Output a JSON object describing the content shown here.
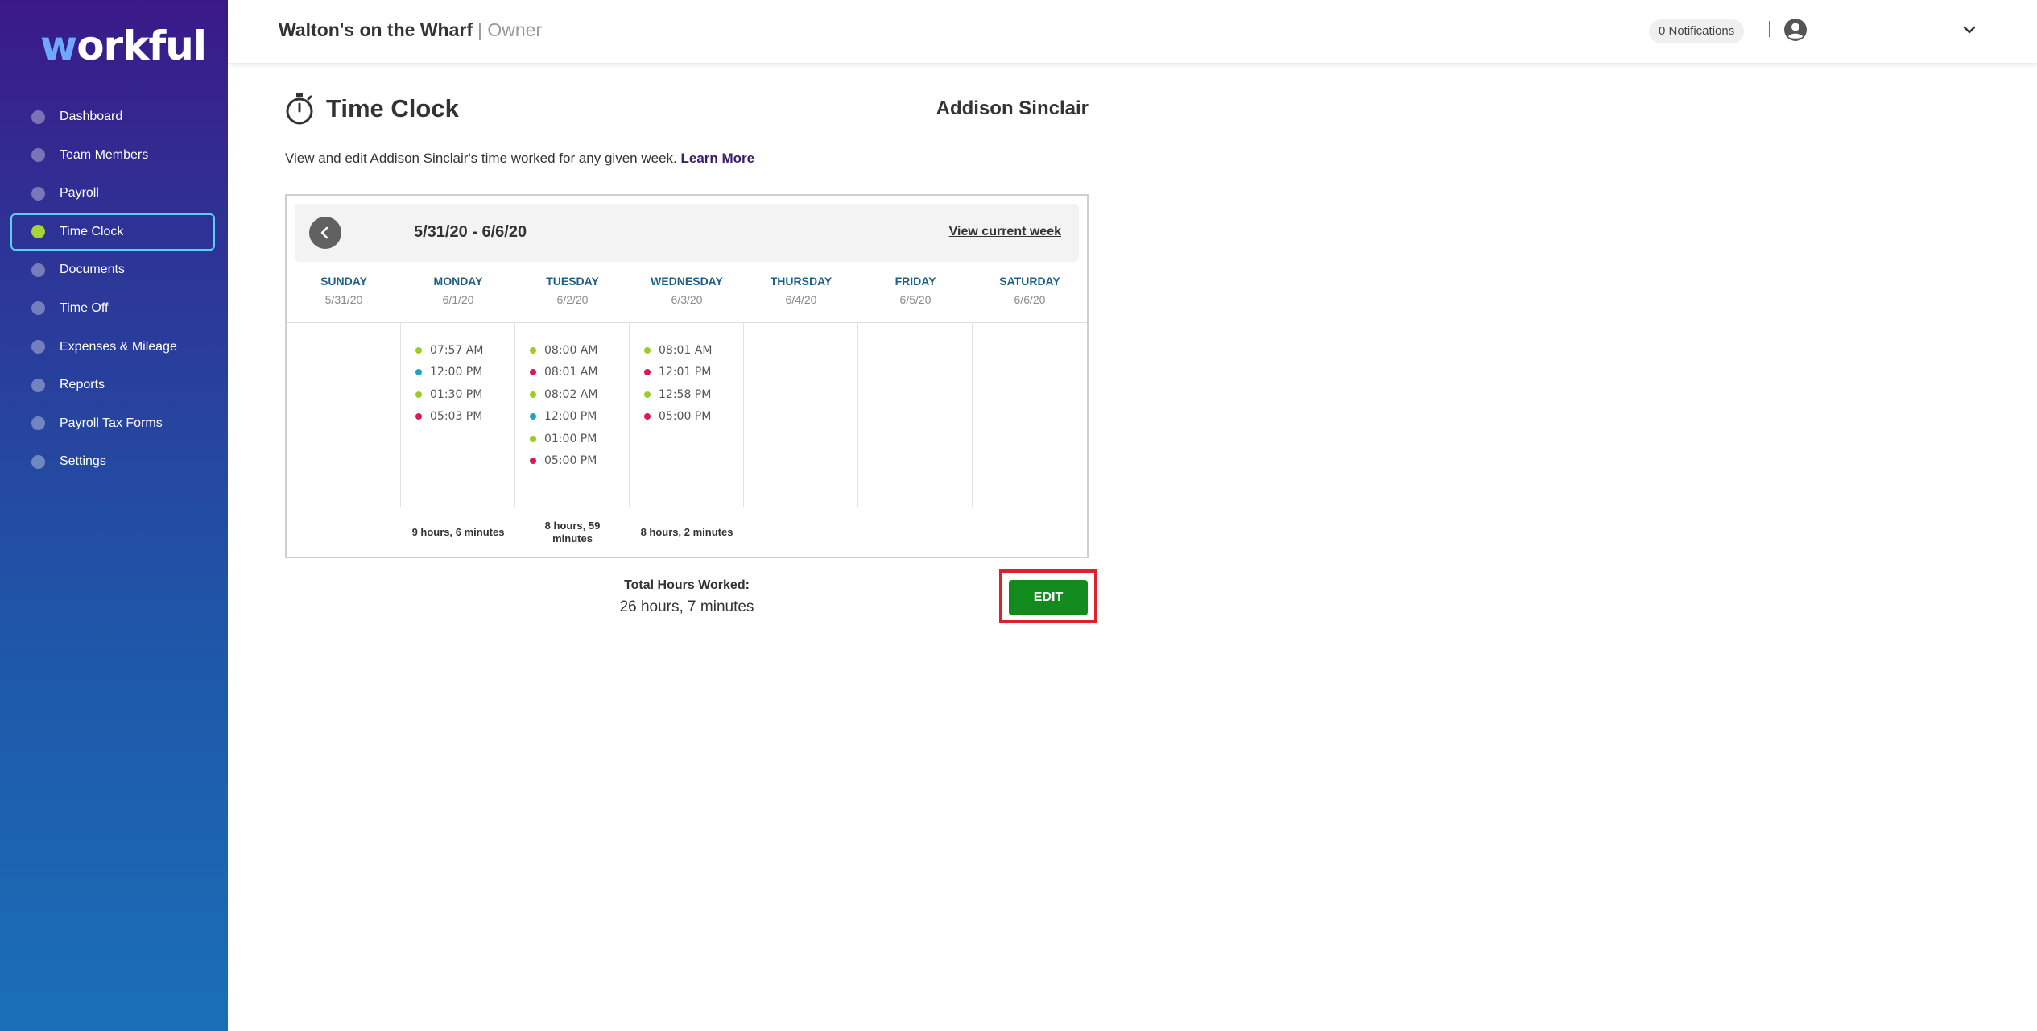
{
  "sidebar": {
    "logo": {
      "prefix": "w",
      "rest": "orkful"
    },
    "items": [
      {
        "label": "Dashboard",
        "active": false
      },
      {
        "label": "Team Members",
        "active": false
      },
      {
        "label": "Payroll",
        "active": false
      },
      {
        "label": "Time Clock",
        "active": true
      },
      {
        "label": "Documents",
        "active": false
      },
      {
        "label": "Time Off",
        "active": false
      },
      {
        "label": "Expenses & Mileage",
        "active": false
      },
      {
        "label": "Reports",
        "active": false
      },
      {
        "label": "Payroll Tax Forms",
        "active": false
      },
      {
        "label": "Settings",
        "active": false
      }
    ]
  },
  "header": {
    "company": "Walton's on the Wharf",
    "role": "| Owner",
    "notifications": "0 Notifications",
    "separator": "|",
    "icons": {
      "user": "user-circle-icon",
      "menu": "chevron-down-icon"
    }
  },
  "page": {
    "title": "Time Clock",
    "employee": "Addison Sinclair",
    "description": "View and edit Addison Sinclair's time worked for any given week.",
    "learn_more": "Learn More",
    "icon": "stopwatch-icon"
  },
  "week": {
    "range": "5/31/20 - 6/6/20",
    "view_current": "View current week",
    "prev_icon": "chevron-left-icon",
    "days": [
      {
        "name": "SUNDAY",
        "date": "5/31/20",
        "punches": [],
        "total": ""
      },
      {
        "name": "MONDAY",
        "date": "6/1/20",
        "punches": [
          {
            "time": "07:57 AM",
            "type": "in"
          },
          {
            "time": "12:00 PM",
            "type": "break"
          },
          {
            "time": "01:30 PM",
            "type": "in"
          },
          {
            "time": "05:03 PM",
            "type": "out"
          }
        ],
        "total": "9 hours, 6 minutes"
      },
      {
        "name": "TUESDAY",
        "date": "6/2/20",
        "punches": [
          {
            "time": "08:00 AM",
            "type": "in"
          },
          {
            "time": "08:01 AM",
            "type": "out"
          },
          {
            "time": "08:02 AM",
            "type": "in"
          },
          {
            "time": "12:00 PM",
            "type": "break"
          },
          {
            "time": "01:00 PM",
            "type": "in"
          },
          {
            "time": "05:00 PM",
            "type": "out"
          }
        ],
        "total": "8 hours, 59 minutes"
      },
      {
        "name": "WEDNESDAY",
        "date": "6/3/20",
        "punches": [
          {
            "time": "08:01 AM",
            "type": "in"
          },
          {
            "time": "12:01 PM",
            "type": "out"
          },
          {
            "time": "12:58 PM",
            "type": "in"
          },
          {
            "time": "05:00 PM",
            "type": "out"
          }
        ],
        "total": "8 hours, 2 minutes"
      },
      {
        "name": "THURSDAY",
        "date": "6/4/20",
        "punches": [],
        "total": ""
      },
      {
        "name": "FRIDAY",
        "date": "6/5/20",
        "punches": [],
        "total": ""
      },
      {
        "name": "SATURDAY",
        "date": "6/6/20",
        "punches": [],
        "total": ""
      }
    ]
  },
  "totals": {
    "label": "Total Hours Worked:",
    "value": "26 hours, 7 minutes"
  },
  "actions": {
    "edit": "EDIT"
  },
  "colors": {
    "punch_in": "#9ccc28",
    "punch_out": "#e0184f",
    "break": "#1fa3c4",
    "edit_button": "#138a1e",
    "highlight": "#e0202b",
    "active_dot": "#a4d438"
  }
}
